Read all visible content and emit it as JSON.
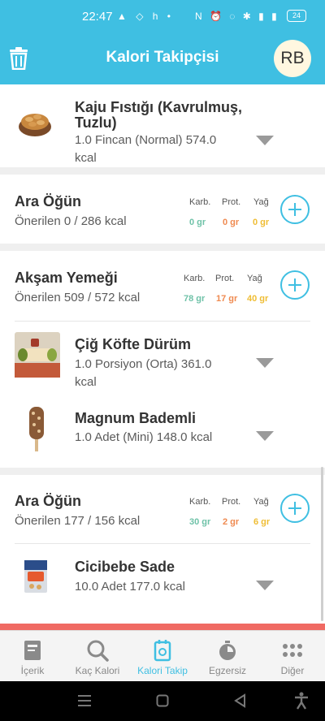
{
  "status": {
    "time": "22:47",
    "left_icons": "▲ ◇ h •",
    "right_icons": "N ⏰ ◌ ✱ ▮ ▮",
    "battery": "24"
  },
  "header": {
    "title": "Kalori Takipçisi",
    "avatar": "RB"
  },
  "top_item": {
    "name_line1": "Kaju Fıstığı (Kavrulmuş,",
    "name_line2": "Tuzlu)",
    "desc_line1": "1.0 Fincan (Normal) 574.0",
    "desc_line2": "kcal"
  },
  "meals": [
    {
      "title": "Ara Öğün",
      "subtitle": "Önerilen 0 / 286 kcal",
      "carb_label": "Karb.",
      "prot_label": "Prot.",
      "fat_label": "Yağ",
      "carb": "0 gr",
      "prot": "0 gr",
      "fat": "0 gr"
    },
    {
      "title": "Akşam Yemeği",
      "subtitle": "Önerilen 509 / 572 kcal",
      "carb_label": "Karb.",
      "prot_label": "Prot.",
      "fat_label": "Yağ",
      "carb": "78 gr",
      "prot": "17 gr",
      "fat": "40 gr",
      "items": [
        {
          "name": "Çiğ Köfte Dürüm",
          "desc_line1": "1.0 Porsiyon (Orta) 361.0",
          "desc_line2": "kcal"
        },
        {
          "name": "Magnum Bademli",
          "desc_line1": "1.0 Adet (Mini) 148.0 kcal"
        }
      ]
    },
    {
      "title": "Ara Öğün",
      "subtitle": "Önerilen 177 / 156 kcal",
      "carb_label": "Karb.",
      "prot_label": "Prot.",
      "fat_label": "Yağ",
      "carb": "30 gr",
      "prot": "2 gr",
      "fat": "6 gr",
      "items": [
        {
          "name": "Cicibebe Sade",
          "desc_line1": "10.0 Adet 177.0 kcal"
        }
      ]
    }
  ],
  "nav": [
    {
      "label": "İçerik"
    },
    {
      "label": "Kaç Kalori"
    },
    {
      "label": "Kalori Takip"
    },
    {
      "label": "Egzersiz"
    },
    {
      "label": "Diğer"
    }
  ],
  "colors": {
    "accent": "#3fbfe2",
    "carb": "#6fc2a8",
    "prot": "#ef8a50",
    "fat": "#efbd34",
    "bottom_line": "#f06a63"
  }
}
